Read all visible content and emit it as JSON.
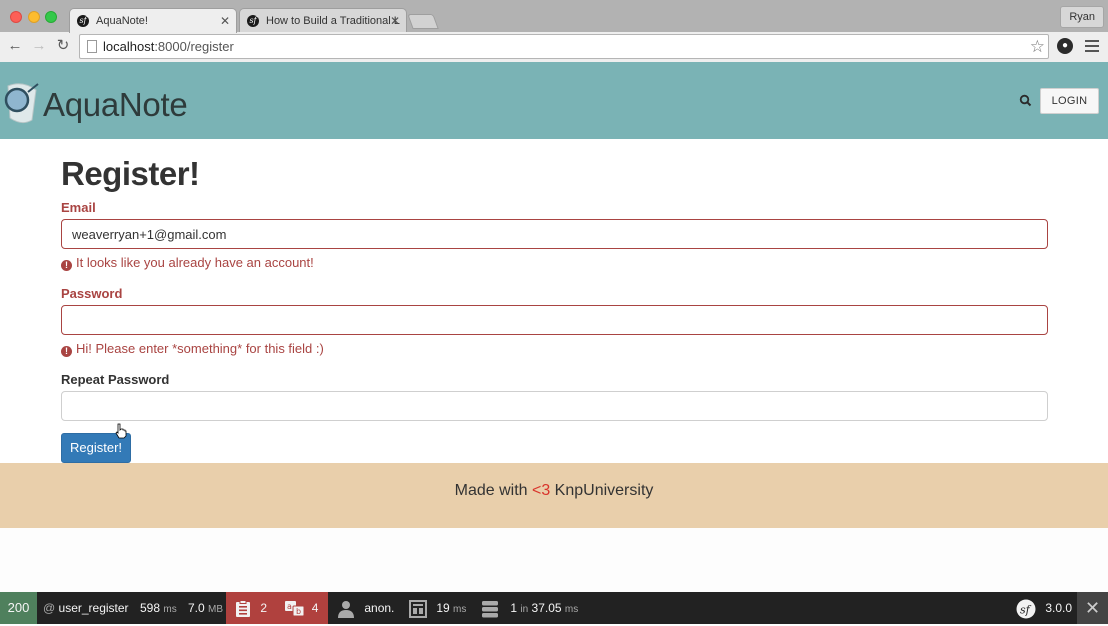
{
  "browser": {
    "tabs": [
      {
        "title": "AquaNote!",
        "active": true
      },
      {
        "title": "How to Build a Traditional L",
        "active": false
      }
    ],
    "profile_name": "Ryan",
    "url_host": "localhost",
    "url_path": ":8000/register"
  },
  "header": {
    "brand": "AquaNote",
    "login_label": "LOGIN"
  },
  "form": {
    "title": "Register!",
    "email": {
      "label": "Email",
      "value": "weaverryan+1@gmail.com",
      "error": "It looks like you already have an account!"
    },
    "password": {
      "label": "Password",
      "value": "",
      "error": "Hi! Please enter *something* for this field :)"
    },
    "repeat_password": {
      "label": "Repeat Password",
      "value": ""
    },
    "submit_label": "Register!"
  },
  "footer": {
    "prefix": "Made with ",
    "heart": "<3",
    "suffix": " KnpUniversity"
  },
  "debug_toolbar": {
    "status": "200",
    "route": "user_register",
    "time_value": "598",
    "time_unit": "ms",
    "memory_value": "7.0",
    "memory_unit": "MB",
    "logs_count": "2",
    "translations_count": "4",
    "user": "anon.",
    "twig_time": "19",
    "twig_unit": "ms",
    "db_queries": "1",
    "db_in": "in",
    "db_time": "37.05",
    "db_unit": "ms",
    "symfony_version": "3.0.0"
  },
  "colors": {
    "header_bg": "#7ab3b5",
    "error": "#a94442",
    "primary_button": "#337ab7",
    "footer_bg": "#e9cfab",
    "status_ok": "#4f805d",
    "logs_bg": "#b0413e"
  }
}
